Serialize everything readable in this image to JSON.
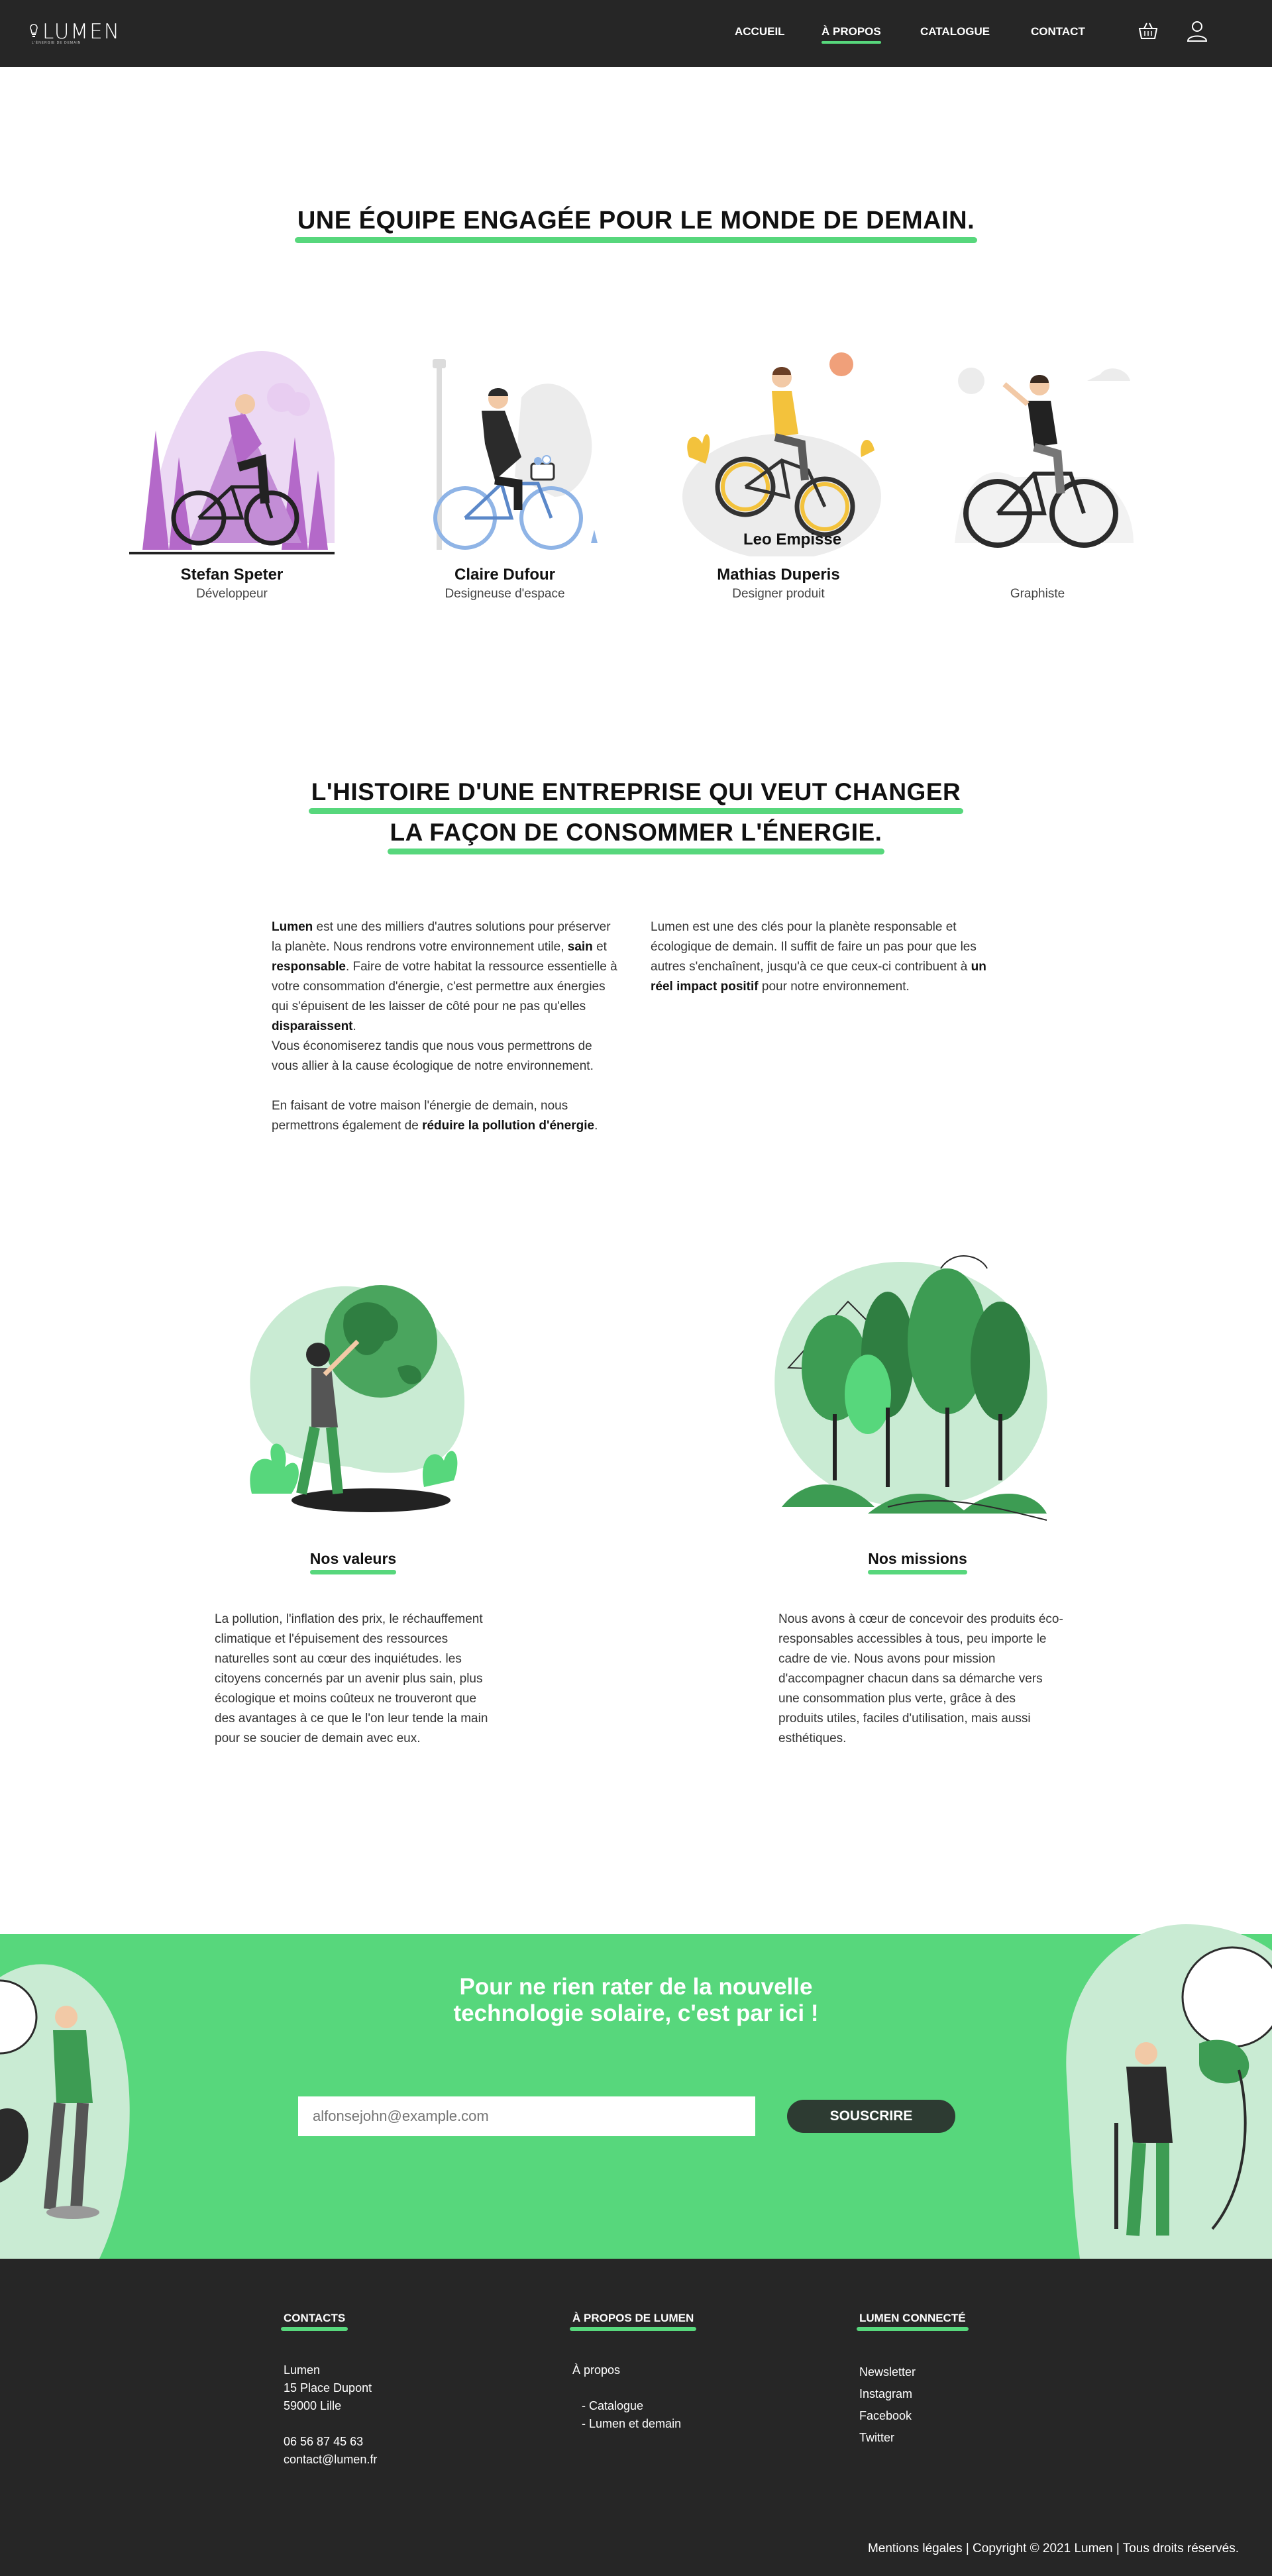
{
  "header": {
    "logo_text": "LUMEN",
    "logo_tagline": "L'ÉNERGIE DE DEMAIN",
    "nav": [
      {
        "label": "ACCUEIL"
      },
      {
        "label": "À PROPOS",
        "active": true
      },
      {
        "label": "CATALOGUE"
      },
      {
        "label": "CONTACT"
      }
    ],
    "icons": [
      "basket-icon",
      "user-icon"
    ]
  },
  "team": {
    "title": "UNE ÉQUIPE ENGAGÉE POUR LE MONDE DE DEMAIN.",
    "members": [
      {
        "name": "Stefan Speter",
        "role": "Développeur"
      },
      {
        "name": "Claire Dufour",
        "role": "Designeuse d'espace"
      },
      {
        "name": "Mathias Duperis",
        "role": "Designer produit"
      },
      {
        "name": "Leo Empisse",
        "role": "Graphiste"
      }
    ]
  },
  "history": {
    "title_line1": "L'HISTOIRE D'UNE ENTREPRISE QUI VEUT CHANGER",
    "title_line2": "LA FAÇON DE CONSOMMER L'ÉNERGIE.",
    "left": {
      "b1": "Lumen",
      "t1": " est une des milliers d'autres solutions pour préserver la planète. Nous rendrons votre environnement utile, ",
      "b2": "sain",
      "t2": " et ",
      "b3": "responsable",
      "t3": ". Faire de votre habitat la ressource essentielle à votre consommation d'énergie, c'est permettre aux énergies qui s'épuisent de les laisser de côté pour ne pas qu'elles ",
      "b4": "disparaissent",
      "t4": ".",
      "p2": "Vous économiserez tandis que nous vous permettrons de vous allier à la cause écologique de notre environnement.",
      "p3a": "En faisant de votre maison l'énergie de demain, nous permettrons également de ",
      "p3b": "réduire la pollution d'énergie",
      "p3c": "."
    },
    "right": {
      "t1": "Lumen est une des clés pour la planète responsable et écologique de demain. Il suffit de faire un pas pour que les autres s'enchaînent, jusqu'à ce que ceux-ci contribuent à ",
      "b1": "un réel impact positif",
      "t2": " pour notre environnement."
    }
  },
  "values": {
    "title": "Nos valeurs",
    "text": "La pollution, l'inflation des prix, le réchauffement climatique et l'épuisement des ressources naturelles sont au cœur des inquiétudes. les citoyens concernés par un avenir plus sain, plus écologique et moins coûteux ne trouveront que des avantages à ce que le l'on leur tende la main pour se soucier de demain avec eux."
  },
  "missions": {
    "title": "Nos missions",
    "text": "Nous avons à cœur de concevoir des produits éco-responsables accessibles à tous, peu importe le cadre de vie. Nous avons pour mission d'accompagner chacun dans sa démarche vers une consommation plus verte, grâce à des produits utiles, faciles d'utilisation, mais aussi esthétiques."
  },
  "newsletter": {
    "title_line1": "Pour ne rien rater de la nouvelle",
    "title_line2": "technologie solaire, c'est par ici !",
    "email_placeholder": "alfonsejohn@example.com",
    "button": "SOUSCRIRE"
  },
  "footer": {
    "contacts": {
      "title": "CONTACTS",
      "lines": [
        "Lumen",
        "15 Place Dupont",
        "59000 Lille"
      ],
      "phone": "06 56 87 45 63",
      "email": "contact@lumen.fr"
    },
    "about": {
      "title": "À PROPOS DE LUMEN",
      "link": "À propos",
      "sub": [
        "- Catalogue",
        "- Lumen et demain"
      ]
    },
    "social": {
      "title": "LUMEN CONNECTÉ",
      "links": [
        "Newsletter",
        "Instagram",
        "Facebook",
        "Twitter"
      ]
    },
    "copyright": "Mentions légales | Copyright © 2021 Lumen | Tous droits réservés."
  },
  "colors": {
    "accent": "#57d77c",
    "dark": "#262626",
    "purple": "#b469c9"
  }
}
